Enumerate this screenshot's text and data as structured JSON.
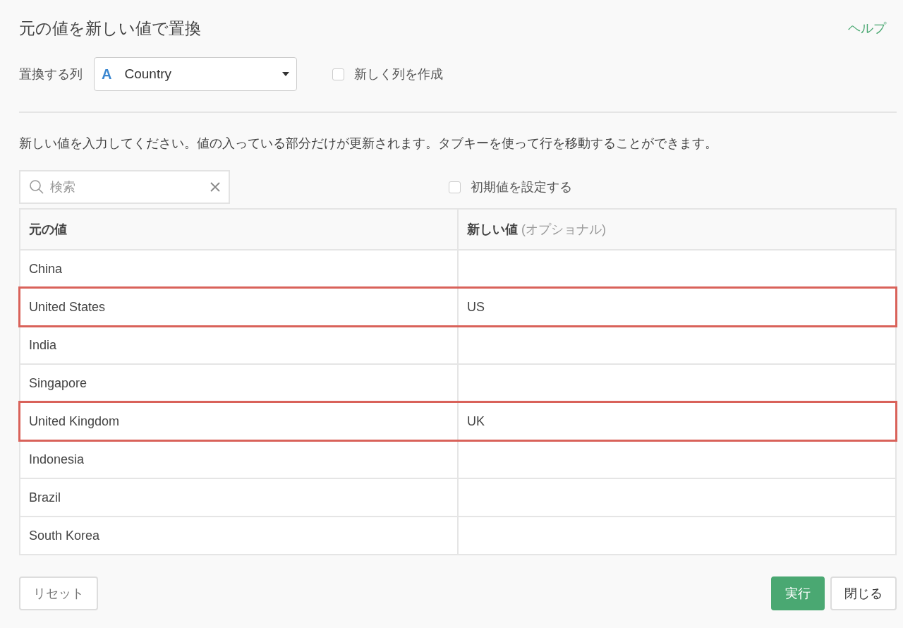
{
  "title": "元の値を新しい値で置換",
  "help_link": "ヘルプ",
  "column_select": {
    "label": "置換する列",
    "type_icon": "A",
    "value": "Country"
  },
  "create_new_column": {
    "label": "新しく列を作成",
    "checked": false
  },
  "instruction": "新しい値を入力してください。値の入っている部分だけが更新されます。タブキーを使って行を移動することができます。",
  "search": {
    "placeholder": "検索"
  },
  "set_default": {
    "label": "初期値を設定する",
    "checked": false
  },
  "table": {
    "columns": [
      {
        "label": "元の値"
      },
      {
        "label": "新しい値",
        "hint": "(オプショナル)"
      }
    ],
    "rows": [
      {
        "original": "China",
        "highlighted": false
      },
      {
        "original": "United States",
        "new_value": "US",
        "highlighted": true
      },
      {
        "original": "India",
        "highlighted": false
      },
      {
        "original": "Singapore",
        "highlighted": false
      },
      {
        "original": "United Kingdom",
        "new_value": "UK",
        "highlighted": true
      },
      {
        "original": "Indonesia",
        "highlighted": false
      },
      {
        "original": "Brazil",
        "highlighted": false
      },
      {
        "original": "South Korea",
        "highlighted": false
      }
    ]
  },
  "buttons": {
    "reset": "リセット",
    "run": "実行",
    "close": "閉じる"
  }
}
